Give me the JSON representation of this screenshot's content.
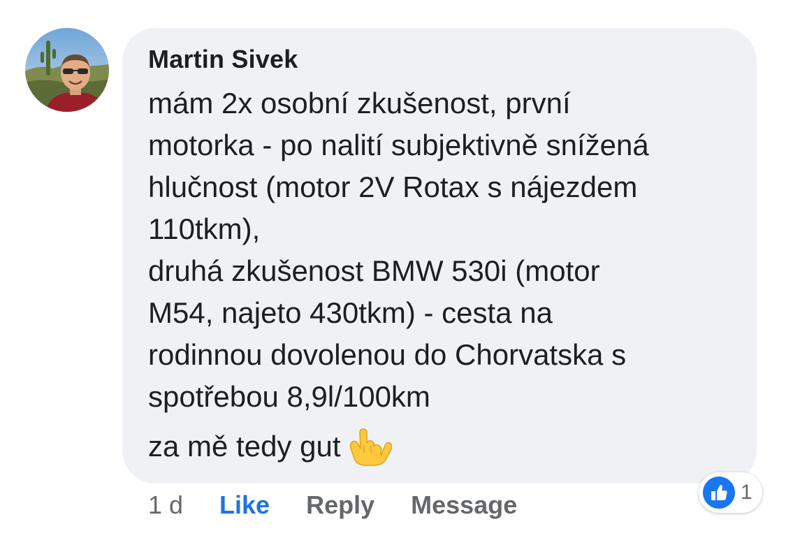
{
  "comment": {
    "author": "Martin Sivek",
    "body_lines": [
      "mám 2x osobní zkušenost, první",
      "motorka - po nalití subjektivně snížená",
      "hlučnost (motor 2V Rotax s nájezdem",
      "110tkm),",
      "druhá zkušenost BMW 530i (motor",
      "M54, najeto 430tkm) - cesta na",
      "rodinnou dovolenou do Chorvatska s",
      "spotřebou 8,9l/100km"
    ],
    "closing_line": "za mě tedy gut",
    "closing_emoji": "call-me-hand-emoji"
  },
  "actions": {
    "time": "1 d",
    "like_label": "Like",
    "reply_label": "Reply",
    "message_label": "Message"
  },
  "reactions": {
    "icon": "thumbs-up-icon",
    "count": "1"
  },
  "colors": {
    "bubble": "#eff1f4",
    "text": "#1c1e21",
    "muted": "#65676b",
    "like_blue": "#1b74e4",
    "reaction_blue": "#1877f2"
  }
}
